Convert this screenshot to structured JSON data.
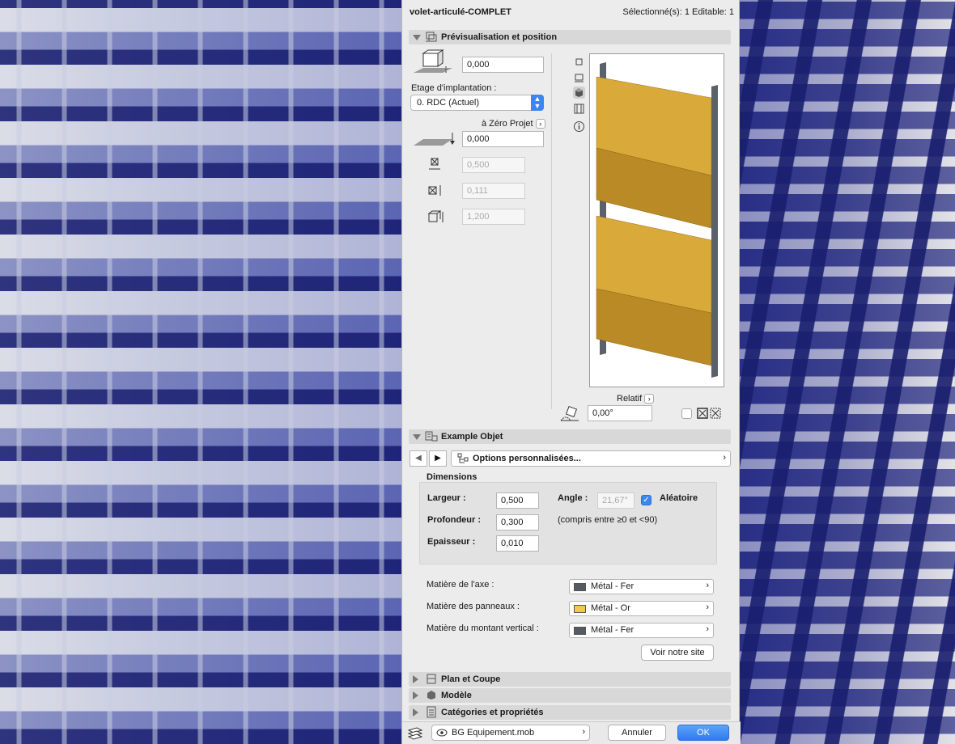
{
  "window": {
    "object_name": "volet-articulé-COMPLET",
    "selection_status": "Sélectionné(s): 1 Editable: 1"
  },
  "preview_section": {
    "title": "Prévisualisation et position",
    "elevation_value": "0,000",
    "story_label": "Etage d'implantation :",
    "story_value": "0. RDC (Actuel)",
    "reference_label": "à Zéro Projet",
    "reference_value": "0,000",
    "dim_x": "0,500",
    "dim_y": "0,111",
    "dim_z": "1,200",
    "relative_label": "Relatif",
    "rotation_value": "0,00°",
    "colors": {
      "panel": "#d8a93a",
      "panel_dark": "#b88a25",
      "post": "#555b63"
    }
  },
  "example_section": {
    "title": "Example Objet",
    "options_label": "Options personnalisées...",
    "dimensions_title": "Dimensions",
    "width_label": "Largeur :",
    "width_value": "0,500",
    "depth_label": "Profondeur :",
    "depth_value": "0,300",
    "thickness_label": "Epaisseur :",
    "thickness_value": "0,010",
    "angle_label": "Angle :",
    "angle_value": "21,67°",
    "random_label": "Aléatoire",
    "random_checked": true,
    "angle_range_note": "(compris entre ≥0 et <90)",
    "axis_material_label": "Matière de l'axe :",
    "axis_material_value": "Métal - Fer",
    "axis_material_color": "#555b63",
    "panel_material_label": "Matière des panneaux :",
    "panel_material_value": "Métal - Or",
    "panel_material_color": "#f2c94c",
    "post_material_label": "Matière du montant vertical :",
    "post_material_value": "Métal - Fer",
    "post_material_color": "#555b63",
    "website_button": "Voir notre site"
  },
  "collapsed_sections": [
    {
      "title": "Plan et Coupe"
    },
    {
      "title": "Modèle"
    },
    {
      "title": "Catégories et propriétés"
    }
  ],
  "footer": {
    "layer_value": "BG Equipement.mob",
    "cancel_label": "Annuler",
    "ok_label": "OK"
  }
}
